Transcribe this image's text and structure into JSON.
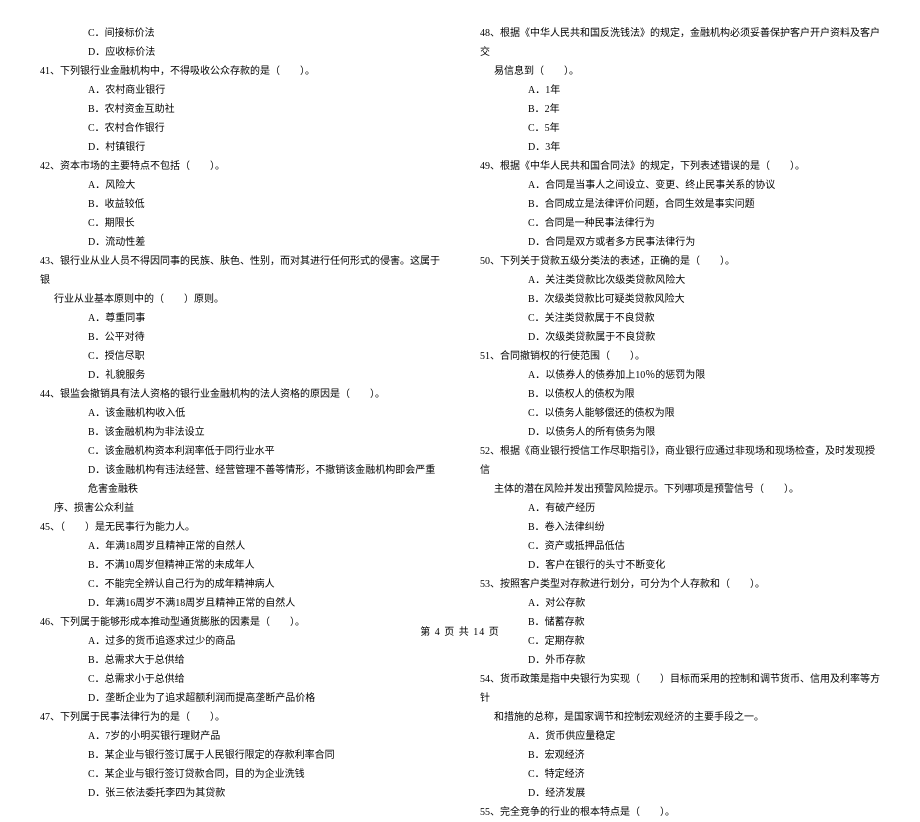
{
  "left": {
    "q40_options_tail": [
      "C．间接标价法",
      "D．应收标价法"
    ],
    "q41": {
      "stem": "41、下列银行业金融机构中，不得吸收公众存款的是（　　）。",
      "options": [
        "A．农村商业银行",
        "B．农村资金互助社",
        "C．农村合作银行",
        "D．村镇银行"
      ]
    },
    "q42": {
      "stem": "42、资本市场的主要特点不包括（　　）。",
      "options": [
        "A．风险大",
        "B．收益较低",
        "C．期限长",
        "D．流动性差"
      ]
    },
    "q43": {
      "stem1": "43、银行业从业人员不得因同事的民族、肤色、性别，而对其进行任何形式的侵害。这属于银",
      "stem2": "行业从业基本原则中的（　　）原则。",
      "options": [
        "A．尊重同事",
        "B．公平对待",
        "C．授信尽职",
        "D．礼貌服务"
      ]
    },
    "q44": {
      "stem": "44、银监会撤销具有法人资格的银行业金融机构的法人资格的原因是（　　）。",
      "options": [
        "A．该金融机构收入低",
        "B．该金融机构为非法设立",
        "C．该金融机构资本利润率低于同行业水平",
        "D．该金融机构有违法经营、经营管理不善等情形，不撤销该金融机构即会严重危害金融秩"
      ],
      "tail": "序、损害公众利益"
    },
    "q45": {
      "stem": "45、（　　）是无民事行为能力人。",
      "options": [
        "A．年满18周岁且精神正常的自然人",
        "B．不满10周岁但精神正常的未成年人",
        "C．不能完全辨认自己行为的成年精神病人",
        "D．年满16周岁不满18周岁且精神正常的自然人"
      ]
    },
    "q46": {
      "stem": "46、下列属于能够形成本推动型通货膨胀的因素是（　　）。",
      "options": [
        "A．过多的货币追逐求过少的商品",
        "B．总需求大于总供给",
        "C．总需求小于总供给",
        "D．垄断企业为了追求超额利润而提高垄断产品价格"
      ]
    },
    "q47": {
      "stem": "47、下列属于民事法律行为的是（　　）。",
      "options": [
        "A．7岁的小明买银行理财产品",
        "B．某企业与银行签订属于人民银行限定的存款利率合同",
        "C．某企业与银行签订贷款合同，目的为企业洗钱",
        "D．张三依法委托李四为其贷款"
      ]
    }
  },
  "right": {
    "q48": {
      "stem1": "48、根据《中华人民共和国反洗钱法》的规定，金融机构必须妥善保护客户开户资料及客户交",
      "stem2": "易信息到（　　）。",
      "options": [
        "A．1年",
        "B．2年",
        "C．5年",
        "D．3年"
      ]
    },
    "q49": {
      "stem": "49、根据《中华人民共和国合同法》的规定，下列表述错误的是（　　）。",
      "options": [
        "A．合同是当事人之间设立、变更、终止民事关系的协议",
        "B．合同成立是法律评价问题，合同生效是事实问题",
        "C．合同是一种民事法律行为",
        "D．合同是双方或者多方民事法律行为"
      ]
    },
    "q50": {
      "stem": "50、下列关于贷款五级分类法的表述，正确的是（　　）。",
      "options": [
        "A．关注类贷款比次级类贷款风险大",
        "B．次级类贷款比可疑类贷款风险大",
        "C．关注类贷款属于不良贷款",
        "D．次级类贷款属于不良贷款"
      ]
    },
    "q51": {
      "stem": "51、合同撤销权的行使范围（　　）。",
      "options": [
        "A．以债券人的债券加上10％的惩罚为限",
        "B．以债权人的债权为限",
        "C．以债务人能够偿还的债权为限",
        "D．以债务人的所有债务为限"
      ]
    },
    "q52": {
      "stem1": "52、根据《商业银行授信工作尽职指引》，商业银行应通过非现场和现场检查，及时发现授信",
      "stem2": "主体的潜在风险并发出预警风险提示。下列哪项是预警信号（　　）。",
      "options": [
        "A．有破产经历",
        "B．卷入法律纠纷",
        "C．资产或抵押品低估",
        "D．客户在银行的头寸不断变化"
      ]
    },
    "q53": {
      "stem": "53、按照客户类型对存款进行划分，可分为个人存款和（　　）。",
      "options": [
        "A．对公存款",
        "B．储蓄存款",
        "C．定期存款",
        "D．外币存款"
      ]
    },
    "q54": {
      "stem1": "54、货币政策是指中央银行为实现（　　）目标而采用的控制和调节货币、信用及利率等方针",
      "stem2": "和措施的总称，是国家调节和控制宏观经济的主要手段之一。",
      "options": [
        "A．货币供应量稳定",
        "B．宏观经济",
        "C．特定经济",
        "D．经济发展"
      ]
    },
    "q55": {
      "stem": "55、完全竞争的行业的根本特点是（　　）。"
    }
  },
  "footer": "第 4 页 共 14 页"
}
